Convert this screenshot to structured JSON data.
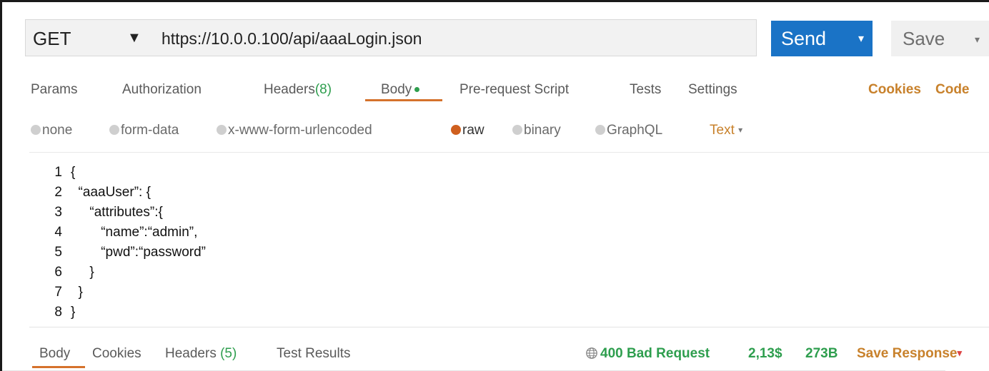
{
  "request": {
    "method": "GET",
    "method_arrow": "▼",
    "url": "https://10.0.0.100/api/aaaLogin.json",
    "send_label": "Send",
    "send_arrow": "▾",
    "save_label": "Save",
    "save_arrow": "▾"
  },
  "tabs": {
    "params": "Params",
    "authorization": "Authorization",
    "headers_label": "Headers",
    "headers_count": "(8)",
    "body": "Body",
    "prerequest": "Pre-request Script",
    "tests": "Tests",
    "settings": "Settings",
    "cookies": "Cookies",
    "code": "Code"
  },
  "body_types": {
    "none": "none",
    "form_data": "form-data",
    "urlencoded": "x-www-form-urlencoded",
    "raw": "raw",
    "binary": "binary",
    "graphql": "GraphQL",
    "format": "Text",
    "format_caret": "▾"
  },
  "editor": {
    "lines": [
      {
        "n": "1",
        "code": "{"
      },
      {
        "n": "2",
        "code": "  “aaaUser”: {"
      },
      {
        "n": "3",
        "code": "     “attributes”:{"
      },
      {
        "n": "4",
        "code": "        “name”:“admin”,"
      },
      {
        "n": "5",
        "code": "        “pwd”:“password”"
      },
      {
        "n": "6",
        "code": "     }"
      },
      {
        "n": "7",
        "code": "  }"
      },
      {
        "n": "8",
        "code": "}"
      }
    ]
  },
  "response": {
    "body": "Body",
    "cookies": "Cookies",
    "headers_label": "Headers",
    "headers_count": "(5)",
    "test_results": "Test Results",
    "status": "400 Bad Request",
    "time": "2,13$",
    "size": "273B",
    "save_response": "Save Response",
    "save_caret": "▾"
  },
  "colors": {
    "accent_blue": "#1a73c6",
    "accent_orange": "#d5722c",
    "status_green": "#2e9e4e",
    "link_orange": "#c8812b"
  }
}
